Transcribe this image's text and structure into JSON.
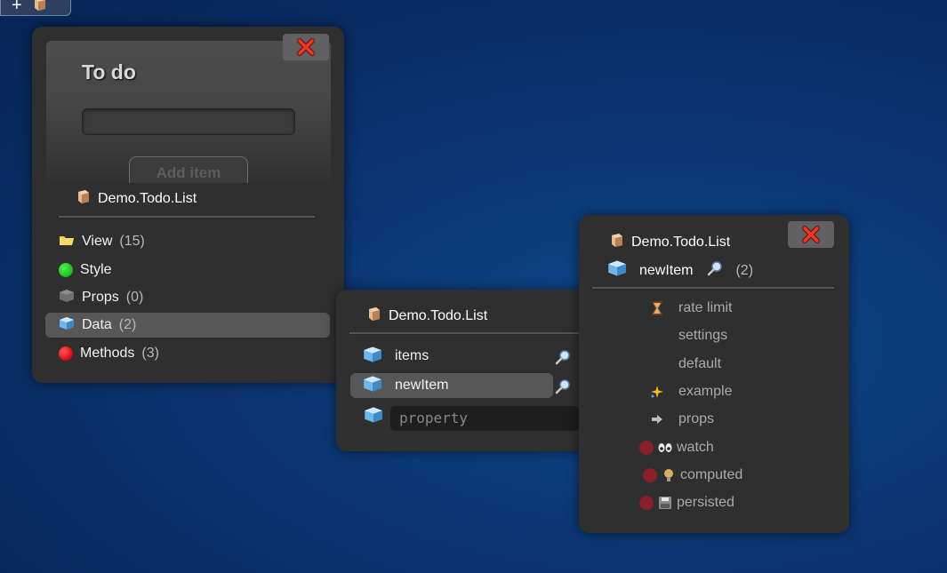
{
  "toolbar": {
    "add_symbol": "+"
  },
  "component_panel": {
    "preview": {
      "title": "To do",
      "button_label": "Add item"
    },
    "breadcrumb": "Demo.Todo.List",
    "sections": [
      {
        "label": "View",
        "count": "(15)",
        "icon": "folder-icon"
      },
      {
        "label": "Style",
        "count": "",
        "icon": "green-dot-icon"
      },
      {
        "label": "Props",
        "count": "(0)",
        "icon": "gray-cube-icon"
      },
      {
        "label": "Data",
        "count": "(2)",
        "icon": "blue-cube-icon",
        "selected": true
      },
      {
        "label": "Methods",
        "count": "(3)",
        "icon": "red-dot-icon"
      }
    ]
  },
  "data_panel": {
    "breadcrumb": "Demo.Todo.List",
    "items": [
      {
        "label": "items"
      },
      {
        "label": "newItem",
        "selected": true
      }
    ],
    "new_property_placeholder": "property"
  },
  "detail_panel": {
    "breadcrumb": "Demo.Todo.List",
    "item": {
      "label": "newItem",
      "count": "(2)"
    },
    "options": [
      {
        "label": "rate limit",
        "icon": "hourglass-icon"
      },
      {
        "label": "settings"
      },
      {
        "label": "default"
      },
      {
        "label": "example",
        "icon": "sparkle-icon"
      },
      {
        "label": "props",
        "icon": "arrow-right-icon"
      },
      {
        "label": "watch",
        "icon": "eyes-icon",
        "toggle": true
      },
      {
        "label": "computed",
        "icon": "lightbulb-icon",
        "toggle": true
      },
      {
        "label": "persisted",
        "icon": "floppy-disk-icon",
        "toggle": true
      }
    ]
  },
  "colors": {
    "background": "#0a3470",
    "panel": "#2f2f2f",
    "highlight": "#575757",
    "close_x": "#e23a25",
    "green": "#1ec81e",
    "red": "#e0101a",
    "toggle_off": "#8a1e2a"
  }
}
